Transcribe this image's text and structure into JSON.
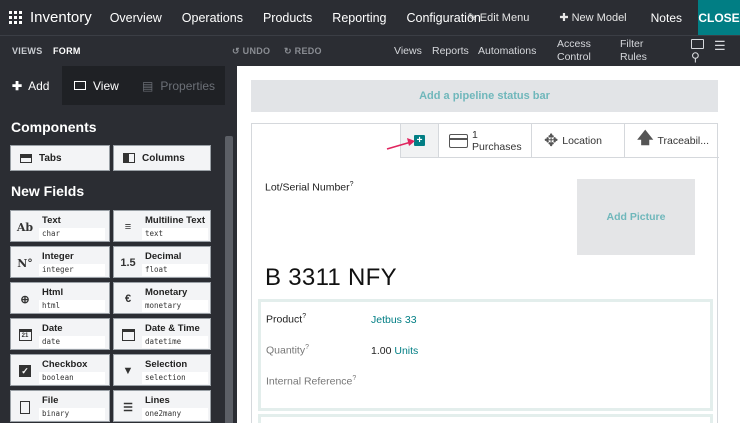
{
  "navbar": {
    "brand": "Inventory",
    "menu": [
      "Overview",
      "Operations",
      "Products",
      "Reporting",
      "Configuration"
    ],
    "edit_menu": "Edit Menu",
    "new_model": "New Model",
    "notes": "Notes",
    "close": "CLOSE"
  },
  "subbar": {
    "tabs": [
      "VIEWS",
      "FORM"
    ],
    "undo": "UNDO",
    "redo": "REDO",
    "views": "Views",
    "reports": "Reports",
    "automations": "Automations",
    "access_control": [
      "Access",
      "Control"
    ],
    "filter_rules": [
      "Filter",
      "Rules"
    ]
  },
  "sidebar": {
    "tabs": {
      "add": "Add",
      "view": "View",
      "properties": "Properties"
    },
    "components_title": "Components",
    "components": [
      "Tabs",
      "Columns"
    ],
    "new_fields_title": "New Fields",
    "fields": [
      {
        "label": "Text",
        "type": "char",
        "icon": "Ab"
      },
      {
        "label": "Multiline Text",
        "type": "text",
        "icon": "lines-icon"
      },
      {
        "label": "Integer",
        "type": "integer",
        "icon": "N°"
      },
      {
        "label": "Decimal",
        "type": "float",
        "icon": "1.5"
      },
      {
        "label": "Html",
        "type": "html",
        "icon": "globe-icon"
      },
      {
        "label": "Monetary",
        "type": "monetary",
        "icon": "euro-icon"
      },
      {
        "label": "Date",
        "type": "date",
        "icon": "calendar-icon"
      },
      {
        "label": "Date & Time",
        "type": "datetime",
        "icon": "calendar-clock-icon"
      },
      {
        "label": "Checkbox",
        "type": "boolean",
        "icon": "checkbox-icon"
      },
      {
        "label": "Selection",
        "type": "selection",
        "icon": "caret-down-icon"
      },
      {
        "label": "File",
        "type": "binary",
        "icon": "file-icon"
      },
      {
        "label": "Lines",
        "type": "one2many",
        "icon": "list-icon"
      }
    ]
  },
  "form": {
    "pipeline": "Add a pipeline status bar",
    "smart_buttons": {
      "purchases_count": "1",
      "purchases_label": "Purchases",
      "location": "Location",
      "traceability": "Traceabil..."
    },
    "lot_label": "Lot/Serial Number",
    "add_picture": "Add Picture",
    "title": "B 3311 NFY",
    "fields": {
      "product_label": "Product",
      "product_value": "Jetbus 33",
      "quantity_label": "Quantity",
      "quantity_value": "1.00",
      "quantity_unit": "Units",
      "internal_ref_label": "Internal Reference"
    },
    "help_mark": "?"
  },
  "colors": {
    "teal": "#017e84",
    "dark": "#2b2d33",
    "accent_arrow": "#e0245e"
  }
}
